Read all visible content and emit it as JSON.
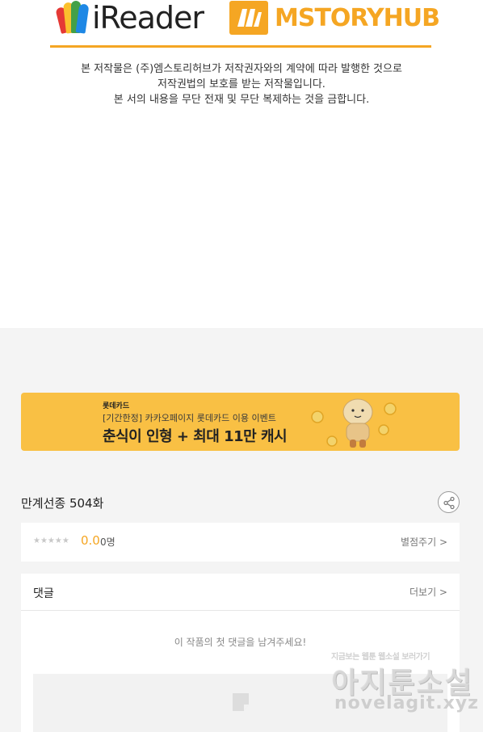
{
  "header": {
    "logo_ireader": "iReader",
    "logo_mstory": "MSTORYHUB"
  },
  "copyright": {
    "line1": "본 저작물은 (주)엠스토리허브가 저작권자와의 계약에 따라 발행한 것으로",
    "line2": "저작권법의 보호를 받는 저작물입니다.",
    "line3": "본 서의 내용을 무단 전재 및 무단 복제하는 것을 금합니다."
  },
  "banner": {
    "brand": "롯데카드",
    "subtitle": "[기간한정] 카카오페이지 롯데카드 이용 이벤트",
    "headline": "춘식이 인형 + 최대 11만 캐시",
    "bg_color": "#f9c044"
  },
  "episode": {
    "title": "만계선종 504화"
  },
  "rating": {
    "stars": "★★★★★",
    "score": "0.0",
    "count": "0명",
    "rate_link": "별점주기 >"
  },
  "comments": {
    "title": "댓글",
    "more_link": "더보기 >",
    "empty_message": "이 작품의 첫 댓글을 남겨주세요!"
  },
  "watermark": {
    "tagline": "지금보는 웹툰 웹소설 보러가기",
    "name": "아지툰소설",
    "url": "novelagit.xyz"
  },
  "colors": {
    "accent": "#f5a623",
    "page_bg": "#f4f4f4"
  }
}
